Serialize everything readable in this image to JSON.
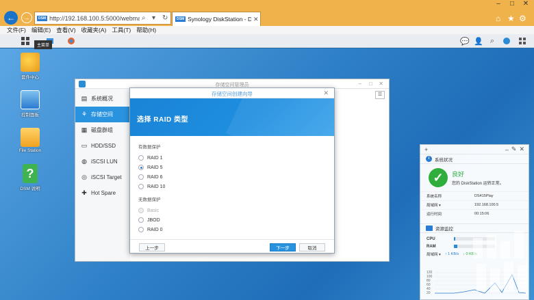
{
  "browser": {
    "url": "http://192.168.100.5:5000/webman/ir",
    "tab_title": "Synology DiskStation - D...",
    "dsm_badge": "DSM"
  },
  "menu": [
    "文件(F)",
    "编辑(E)",
    "查看(V)",
    "收藏夹(A)",
    "工具(T)",
    "帮助(H)"
  ],
  "taskbar": {
    "tooltip": "主菜单"
  },
  "desktop_icons": [
    {
      "label": "套件中心"
    },
    {
      "label": "控制面板"
    },
    {
      "label": "File Station"
    },
    {
      "label": "DSM 说明"
    }
  ],
  "storage_manager": {
    "title": "存储空间管理员",
    "sidebar": [
      {
        "label": "系统概况",
        "icon": "overview-icon"
      },
      {
        "label": "存储空间",
        "icon": "storage-icon",
        "active": true
      },
      {
        "label": "磁盘群组",
        "icon": "disk-group-icon"
      },
      {
        "label": "HDD/SSD",
        "icon": "hdd-icon"
      },
      {
        "label": "iSCSI LUN",
        "icon": "lun-icon"
      },
      {
        "label": "iSCSI Target",
        "icon": "target-icon"
      },
      {
        "label": "Hot Spare",
        "icon": "hotspare-icon"
      }
    ]
  },
  "wizard": {
    "title": "存储空间创建向导",
    "heading": "选择 RAID 类型",
    "group_protected": "有数据保护",
    "options_protected": [
      {
        "label": "RAID 1",
        "checked": false
      },
      {
        "label": "RAID 5",
        "checked": true
      },
      {
        "label": "RAID 6",
        "checked": false
      },
      {
        "label": "RAID 10",
        "checked": false
      }
    ],
    "group_unprotected": "无数据保护",
    "options_unprotected": [
      {
        "label": "Basic",
        "disabled": true
      },
      {
        "label": "JBOD",
        "disabled": false
      },
      {
        "label": "RAID 0",
        "disabled": false
      }
    ],
    "btn_prev": "上一步",
    "btn_next": "下一步",
    "btn_cancel": "取消"
  },
  "widget": {
    "health_title": "系统状况",
    "status": "良好",
    "status_desc": "您的 DiskStation 运转正常。",
    "rows": [
      {
        "k": "系统名称",
        "v": "DS415Play"
      },
      {
        "k": "局域网 ▾",
        "v": "192.168.100.5"
      },
      {
        "k": "运行时间",
        "v": "00:15:06"
      }
    ],
    "resource_title": "资源监控",
    "cpu_label": "CPU",
    "cpu_fraction": 0.03,
    "ram_label": "RAM",
    "ram_fraction": 0.08,
    "net_label": "局域网 ▾",
    "net_up": "↑ 1 KB/s",
    "net_down": "↓ 0 KB/s",
    "graph_ticks": [
      "120",
      "100",
      "80",
      "60",
      "40",
      "20"
    ]
  },
  "colors": {
    "accent": "#2a93e0",
    "ok": "#2fae3e",
    "browser_frame": "#f0b24b"
  }
}
